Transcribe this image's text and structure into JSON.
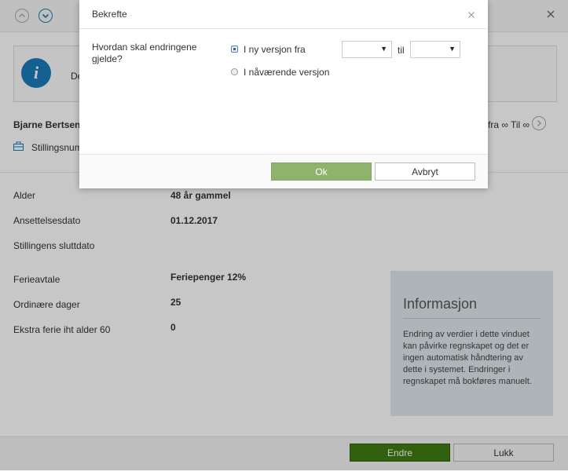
{
  "background": {
    "info_banner_text": "De",
    "employee_name": "Bjarne Bertsen",
    "position_label": "Stillingsnum",
    "version_range": "fra ∞ Til ∞",
    "fields": [
      {
        "label": "Alder",
        "value": "48 år gammel"
      },
      {
        "label": "Ansettelsesdato",
        "value": "01.12.2017"
      },
      {
        "label": "Stillingens sluttdato",
        "value": ""
      },
      {
        "label": "Ferieavtale",
        "value": "Feriepenger 12%"
      },
      {
        "label": "Ordinære dager",
        "value": "25"
      },
      {
        "label": "Ekstra ferie iht alder 60",
        "value": "0"
      }
    ],
    "info_box": {
      "title": "Informasjon",
      "text": "Endring av verdier i dette vinduet kan påvirke regnskapet og det er ingen automatisk håndtering av dette i systemet. Endringer i regnskapet må bokføres manuelt."
    },
    "buttons": {
      "change": "Endre",
      "close": "Lukk"
    },
    "icons": {
      "up": "chevron-up-icon",
      "down": "chevron-down-icon",
      "close": "close-icon",
      "info": "info-icon",
      "next": "chevron-right-icon",
      "position": "position-icon"
    }
  },
  "dialog": {
    "title": "Bekrefte",
    "question": "Hvordan skal endringene gjelde?",
    "options": [
      {
        "label": "I ny versjon fra",
        "selected": true
      },
      {
        "label": "I nåværende versjon",
        "selected": false
      }
    ],
    "from_select_value": "",
    "to_label": "til",
    "to_select_value": "",
    "ok_label": "Ok",
    "cancel_label": "Avbryt"
  },
  "colors": {
    "primary_green": "#3f7d12",
    "ok_green": "#8db36c",
    "info_blue": "#1a7bb9",
    "info_box_bg": "#dfe8ee"
  }
}
